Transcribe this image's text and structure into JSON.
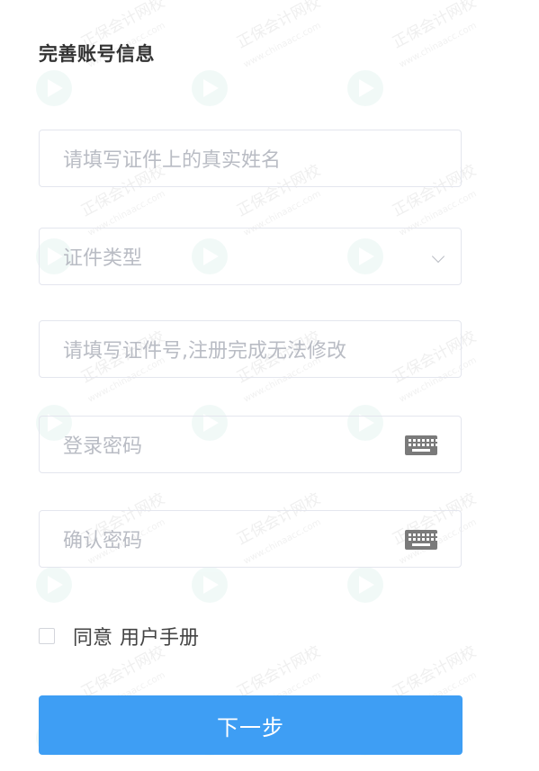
{
  "form": {
    "title": "完善账号信息",
    "name_placeholder": "请填写证件上的真实姓名",
    "id_type_placeholder": "证件类型",
    "id_number_placeholder": "请填写证件号,注册完成无法修改",
    "password_placeholder": "登录密码",
    "confirm_password_placeholder": "确认密码",
    "agree_label": "同意",
    "agree_link": "用户手册",
    "next_button": "下一步"
  },
  "watermark": {
    "text": "正保会计网校",
    "url": "www.chinaacc.com"
  },
  "icons": {
    "dropdown": "chevron-down-icon",
    "keyboard": "keyboard-icon"
  },
  "colors": {
    "primary_button": "#3e9ef4",
    "placeholder": "#b9bcc4",
    "field_border": "#e4e6ee"
  }
}
